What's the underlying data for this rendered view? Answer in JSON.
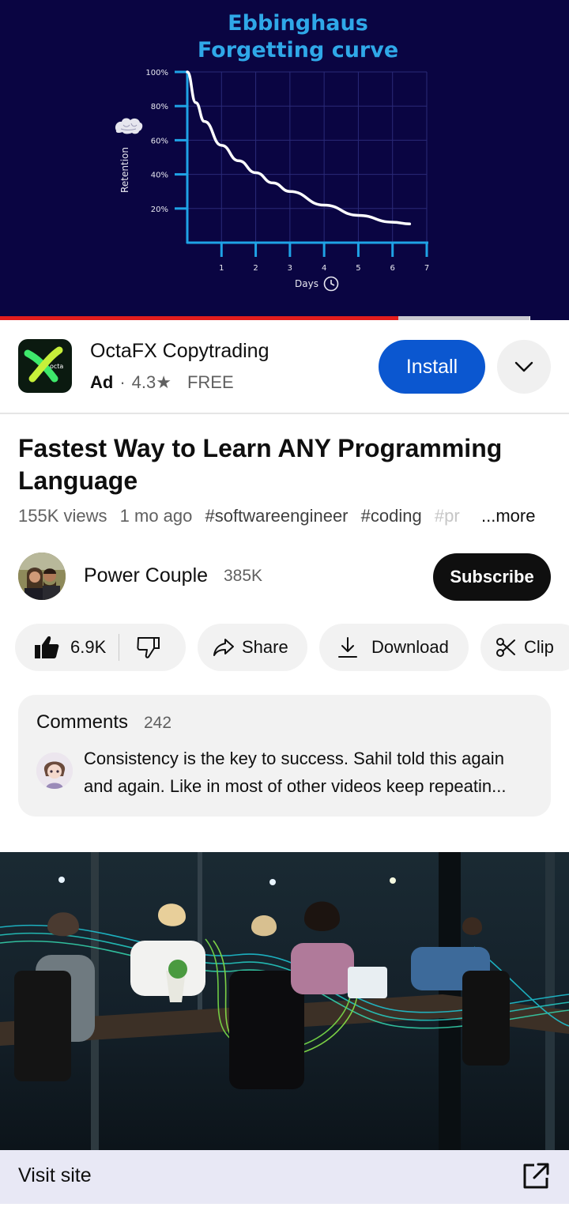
{
  "video": {
    "thumbnail_title_line1": "Ebbinghaus",
    "thumbnail_title_line2": "Forgetting curve",
    "progress_fraction": 0.7,
    "buffer_fraction": 0.93,
    "chart_data": {
      "type": "line",
      "title": "Ebbinghaus Forgetting curve",
      "xlabel": "Days",
      "ylabel": "Retention",
      "x_ticks": [
        "1",
        "2",
        "3",
        "4",
        "5",
        "6",
        "7"
      ],
      "y_ticks": [
        "100%",
        "80%",
        "60%",
        "40%",
        "20%"
      ],
      "xlim": [
        0,
        7
      ],
      "ylim": [
        0,
        100
      ],
      "series": [
        {
          "x": [
            0,
            0.25,
            0.5,
            1,
            1.5,
            2,
            2.5,
            3,
            4,
            5,
            6,
            6.5
          ],
          "y": [
            100,
            82,
            71,
            57,
            48,
            41,
            35,
            30,
            22,
            16,
            12,
            11
          ]
        }
      ],
      "grid": true
    }
  },
  "ad": {
    "app_name": "OctaFX Copytrading",
    "ad_label": "Ad",
    "separator": "·",
    "rating": "4.3",
    "star": "★",
    "price": "FREE",
    "install_label": "Install",
    "icon_text": "octa"
  },
  "title": "Fastest Way to Learn ANY Programming Language",
  "meta": {
    "views": "155K views",
    "age": "1 mo ago",
    "tag1": "#softwareengineer",
    "tag2": "#coding",
    "tag3": "#pr",
    "more": "...more"
  },
  "channel": {
    "name": "Power Couple",
    "subscribers": "385K",
    "subscribe_label": "Subscribe"
  },
  "actions": {
    "likes": "6.9K",
    "share": "Share",
    "download": "Download",
    "clip": "Clip"
  },
  "comments": {
    "label": "Comments",
    "count": "242",
    "top_comment": "Consistency is the key to success. Sahil told this again and again. Like in most of other videos keep repeatin..."
  },
  "ad_banner": {
    "visit_label": "Visit site"
  },
  "colors": {
    "player_bg": "#0a0542",
    "chart_axis": "#1fa3e6",
    "title_blue": "#2fa8e8",
    "install_blue": "#0b57d0",
    "progress_red": "#e31d1d"
  }
}
